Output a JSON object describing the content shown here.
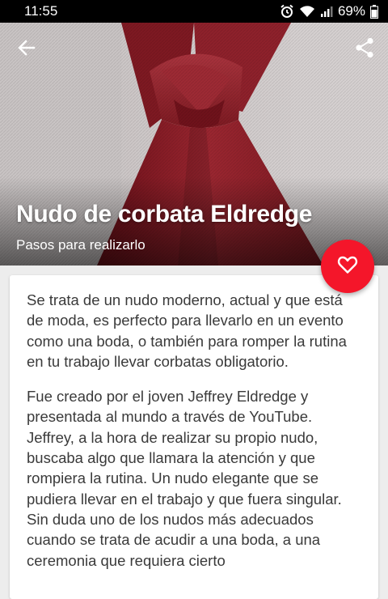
{
  "status_bar": {
    "time": "11:55",
    "battery": "69%",
    "icons": [
      "alarm-icon",
      "wifi-icon",
      "signal-icon",
      "battery-icon"
    ]
  },
  "header": {
    "title": "Nudo de corbata Eldredge",
    "subtitle": "Pasos para realizarlo",
    "back_icon": "arrow-left-icon",
    "share_icon": "share-icon",
    "fab_icon": "heart-icon"
  },
  "colors": {
    "accent": "#f4162a",
    "tie": "#8a1d25"
  },
  "article": {
    "paragraphs": [
      "Se trata de un nudo moderno, actual y que está de moda, es perfecto para llevarlo en un evento como una boda, o también para romper la rutina en tu trabajo llevar corbatas obligatorio.",
      "Fue creado por el joven Jeffrey Eldredge y presentada al mundo a través de YouTube. Jeffrey, a la hora de realizar su propio nudo, buscaba algo que llamara la atención y que rompiera la rutina. Un nudo elegante que se pudiera llevar en el trabajo y que fuera singular. Sin duda uno de los nudos más adecuados cuando se trata de acudir a una boda, a una ceremonia que requiera cierto"
    ]
  }
}
